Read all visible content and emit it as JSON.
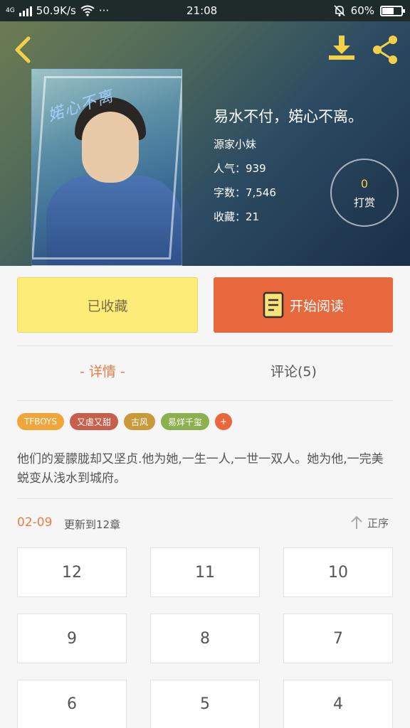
{
  "status_bar": {
    "network": "4G",
    "speed": "50.9K/s",
    "dots": "···",
    "time": "21:08",
    "battery": "60%",
    "battery_level": 0.6
  },
  "header": {
    "back_icon": "chevron-left-icon",
    "download_icon": "download-icon",
    "share_icon": "share-icon",
    "accent_color": "#f4d04a"
  },
  "book": {
    "cover_text": "婼心不离",
    "title": "易水不付，婼心不离。",
    "author": "源家小妹",
    "popularity": "人气：939",
    "word_count": "字数：7,546",
    "favorites": "收藏：21",
    "reward_count": "0",
    "reward_label": "打赏"
  },
  "actions": {
    "collected_label": "已收藏",
    "read_label": "开始阅读",
    "read_icon": "book-icon"
  },
  "tabs": {
    "detail": "- 详情 -",
    "comments": "评论(5)"
  },
  "tags": [
    {
      "label": "TFBOYS",
      "color": "#f0a63a"
    },
    {
      "label": "又虐又甜",
      "color": "#c65f4c"
    },
    {
      "label": "古风",
      "color": "#c99a3a"
    },
    {
      "label": "易烊千玺",
      "color": "#8cb04d"
    },
    {
      "label": "+",
      "color": "#e9673c"
    }
  ],
  "summary": "他们的爱朦胧却又坚贞.他为她,一生一人,一世一双人。她为他,一完美蜕变从浅水到城府。",
  "update": {
    "date": "02-09",
    "text": "更新到12章",
    "sort_label": "正序",
    "sort_icon": "arrow-up-icon"
  },
  "chapters": [
    "12",
    "11",
    "10",
    "9",
    "8",
    "7",
    "6",
    "5",
    "4"
  ]
}
